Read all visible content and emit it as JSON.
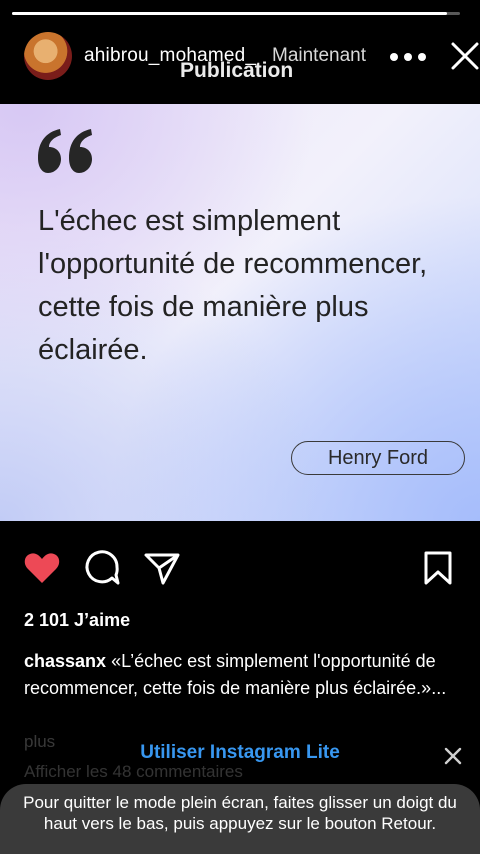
{
  "story": {
    "progress": 0.97,
    "username": "ahibrou_mohamed_",
    "timestamp": "Maintenant",
    "title": "Publication",
    "more_icon": "more-horizontal-icon",
    "close_icon": "close-icon"
  },
  "post": {
    "quote_icon": "quote-icon",
    "quote": "L'échec est simplement l'opportunité de recommencer, cette fois de manière plus éclairée.",
    "author": "Henry Ford",
    "like_icon": "heart-filled-icon",
    "like_color": "#ed4956",
    "comment_icon": "comment-icon",
    "share_icon": "send-icon",
    "save_icon": "bookmark-icon",
    "likes": "2 101 J’aime",
    "caption_user": "chassanx",
    "caption_text": " «L’échec est simplement l'opportunité de recommencer, cette fois de manière plus éclairée.»...",
    "more_label": "plus",
    "comments_label": "Afficher les 48 commentaires"
  },
  "banner": {
    "link_label": "Utiliser Instagram Lite",
    "link_color": "#3897f0",
    "close_icon": "close-icon"
  },
  "toast": {
    "message": "Pour quitter le mode plein écran, faites glisser un doigt du haut vers le bas, puis appuyez sur le bouton Retour."
  }
}
